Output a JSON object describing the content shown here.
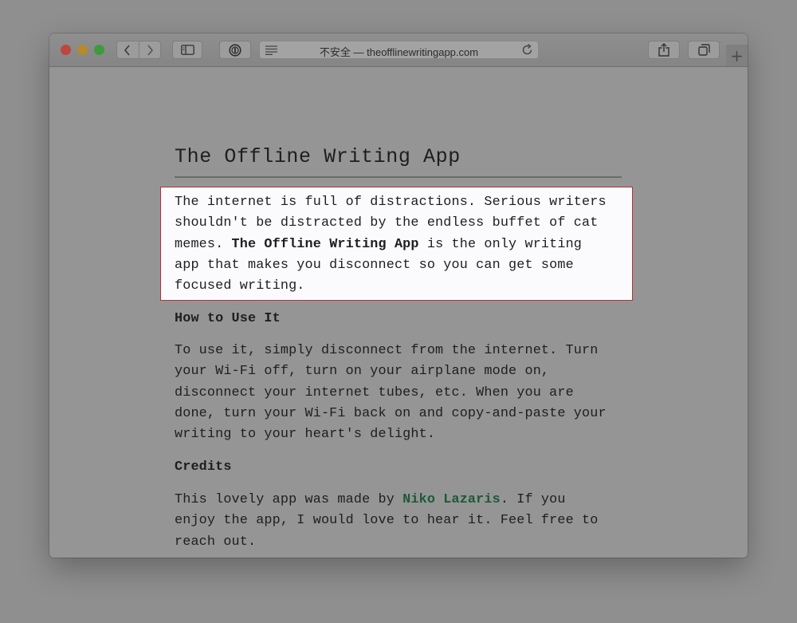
{
  "browser": {
    "address_text": "不安全 — theofflinewritingapp.com",
    "new_tab_label": "+"
  },
  "page": {
    "title": "The Offline Writing App",
    "intro": {
      "line1": "The internet is full of distractions. Serious writers",
      "line2": "shouldn't be distracted by the endless buffet of cat",
      "line3_before": "memes. ",
      "line3_bold": "The Offline Writing App",
      "line3_after": " is the only writing",
      "line4": "app that makes you disconnect so you can get some",
      "line5": "focused writing."
    },
    "how_heading": "How to Use It",
    "how": {
      "line1": "To use it, simply disconnect from the internet. Turn",
      "line2": "your Wi-Fi off, turn on your airplane mode on,",
      "line3": "disconnect your internet tubes, etc. When you are",
      "line4": "done, turn your Wi-Fi back on and copy-and-paste your",
      "line5": "writing to your heart's delight."
    },
    "credits_heading": "Credits",
    "credits": {
      "line1_before": "This lovely app was made by ",
      "line1_link": "Niko Lazaris",
      "line1_after": ". If you",
      "line2": "enjoy the app, I would love to hear it. Feel free to",
      "line3": "reach out."
    }
  },
  "colors": {
    "highlight_border": "#b5303a",
    "link": "#1d5a35"
  }
}
